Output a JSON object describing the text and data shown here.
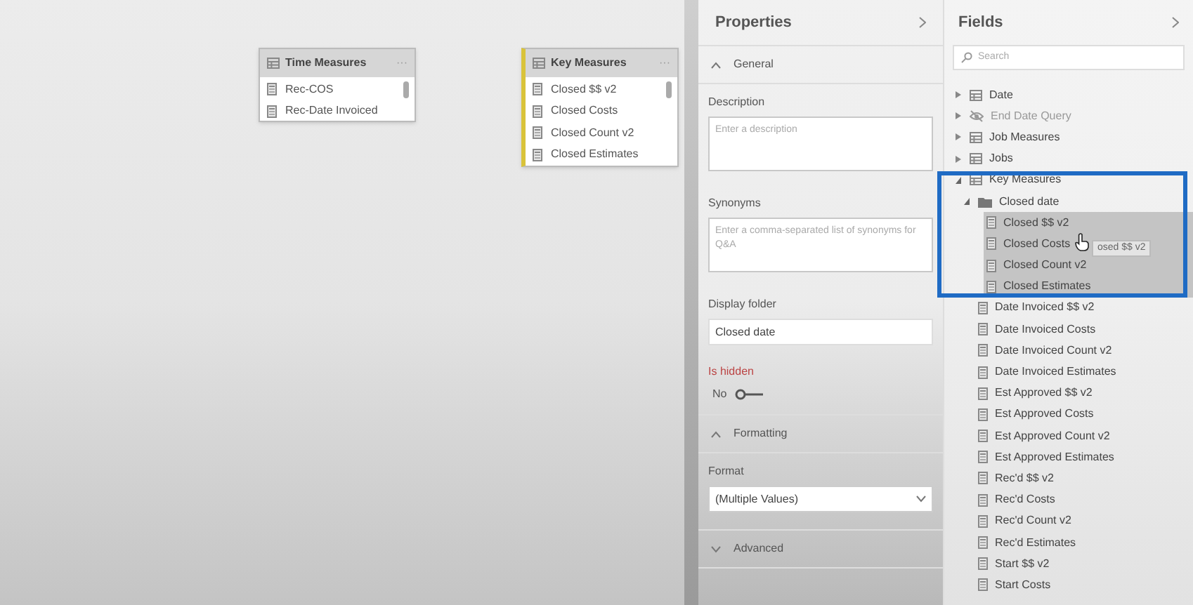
{
  "model_canvas": {
    "tables": [
      {
        "title": "Time Measures",
        "menu": "···",
        "selected": false,
        "fields": [
          "Rec-COS",
          "Rec-Date Invoiced"
        ]
      },
      {
        "title": "Key Measures",
        "menu": "···",
        "selected": true,
        "fields": [
          "Closed $$ v2",
          "Closed Costs",
          "Closed Count v2",
          "Closed Estimates"
        ]
      }
    ]
  },
  "properties": {
    "title": "Properties",
    "sections": [
      {
        "title": "General",
        "expanded": true,
        "fields": [
          {
            "kind": "textarea",
            "label": "Description",
            "placeholder": "Enter a description"
          },
          {
            "kind": "textarea",
            "label": "Synonyms",
            "placeholder": "Enter a comma-separated list of synonyms for Q&A"
          },
          {
            "kind": "input",
            "label": "Display folder",
            "value": "Closed date"
          },
          {
            "kind": "toggle",
            "label": "Is hidden",
            "value": "No",
            "on": false
          }
        ]
      },
      {
        "title": "Formatting",
        "expanded": true,
        "fields": [
          {
            "kind": "select",
            "label": "Format",
            "value": "(Multiple Values)"
          }
        ]
      },
      {
        "title": "Advanced",
        "expanded": false
      }
    ]
  },
  "fields": {
    "title": "Fields",
    "search": {
      "placeholder": "Search"
    },
    "drag_ghost": "osed $$ v2",
    "tree": [
      {
        "kind": "table",
        "label": "Date",
        "expanded": false,
        "selected": false
      },
      {
        "kind": "hidden-table",
        "label": "End Date Query",
        "expanded": false,
        "selected": false
      },
      {
        "kind": "table",
        "label": "Job Measures",
        "expanded": false,
        "selected": false
      },
      {
        "kind": "table",
        "label": "Jobs",
        "expanded": false,
        "selected": false
      },
      {
        "kind": "table",
        "label": "Key Measures",
        "expanded": true,
        "selected": false,
        "highlighted": true,
        "children": [
          {
            "kind": "folder",
            "label": "Closed date",
            "expanded": true,
            "selected": false,
            "children": [
              {
                "kind": "measure",
                "label": "Closed $$ v2",
                "selected": true
              },
              {
                "kind": "measure",
                "label": "Closed Costs",
                "selected": true
              },
              {
                "kind": "measure",
                "label": "Closed Count v2",
                "selected": true
              },
              {
                "kind": "measure",
                "label": "Closed Estimates",
                "selected": true
              }
            ]
          },
          {
            "kind": "measure",
            "label": "Date Invoiced $$ v2",
            "selected": false
          },
          {
            "kind": "measure",
            "label": "Date Invoiced Costs",
            "selected": false
          },
          {
            "kind": "measure",
            "label": "Date Invoiced Count v2",
            "selected": false
          },
          {
            "kind": "measure",
            "label": "Date Invoiced Estimates",
            "selected": false
          },
          {
            "kind": "measure",
            "label": "Est Approved $$ v2",
            "selected": false
          },
          {
            "kind": "measure",
            "label": "Est Approved Costs",
            "selected": false
          },
          {
            "kind": "measure",
            "label": "Est Approved Count v2",
            "selected": false
          },
          {
            "kind": "measure",
            "label": "Est Approved Estimates",
            "selected": false
          },
          {
            "kind": "measure",
            "label": "Rec'd $$ v2",
            "selected": false
          },
          {
            "kind": "measure",
            "label": "Rec'd Costs",
            "selected": false
          },
          {
            "kind": "measure",
            "label": "Rec'd Count v2",
            "selected": false
          },
          {
            "kind": "measure",
            "label": "Rec'd Estimates",
            "selected": false
          },
          {
            "kind": "measure",
            "label": "Start $$ v2",
            "selected": false
          },
          {
            "kind": "measure",
            "label": "Start Costs",
            "selected": false
          }
        ]
      }
    ]
  }
}
